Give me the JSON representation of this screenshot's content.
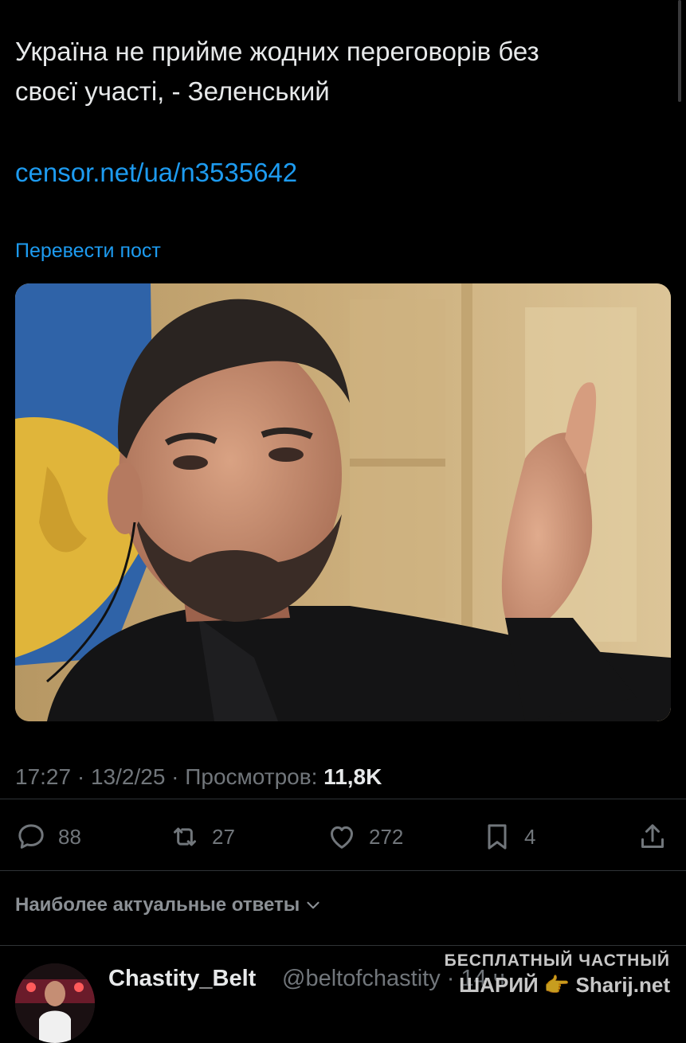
{
  "post": {
    "text_line1": "Україна не прийме жодних переговорів без",
    "text_line2": "своєї участі, - Зеленський",
    "link": "censor.net/ua/n3535642",
    "translate_label": "Перевести пост"
  },
  "meta": {
    "time": "17:27",
    "sep1": " · ",
    "date": "13/2/25",
    "sep2": " · ",
    "views_label": "Просмотров: ",
    "views_count": "11,8K"
  },
  "actions": {
    "replies": "88",
    "reposts": "27",
    "likes": "272",
    "bookmarks": "4"
  },
  "replies_section": {
    "sort_label": "Наиболее актуальные ответы"
  },
  "reply": {
    "author_name": "Chastity_Belt",
    "author_handle": "@beltofchastity · 14 ч"
  },
  "watermark": {
    "line1": "БЕСПЛАТНЫЙ ЧАСТНЫЙ",
    "line2": "ШАРИЙ 👉 Sharij.net"
  },
  "icons": {
    "reply": "reply-icon",
    "repost": "repost-icon",
    "like": "heart-icon",
    "bookmark": "bookmark-icon",
    "share": "share-icon",
    "chevron": "chevron-down-icon"
  },
  "colors": {
    "background": "#000000",
    "text": "#e7e9ea",
    "secondary": "#71767b",
    "accent": "#1d9bf0",
    "divider": "#2f3336"
  }
}
